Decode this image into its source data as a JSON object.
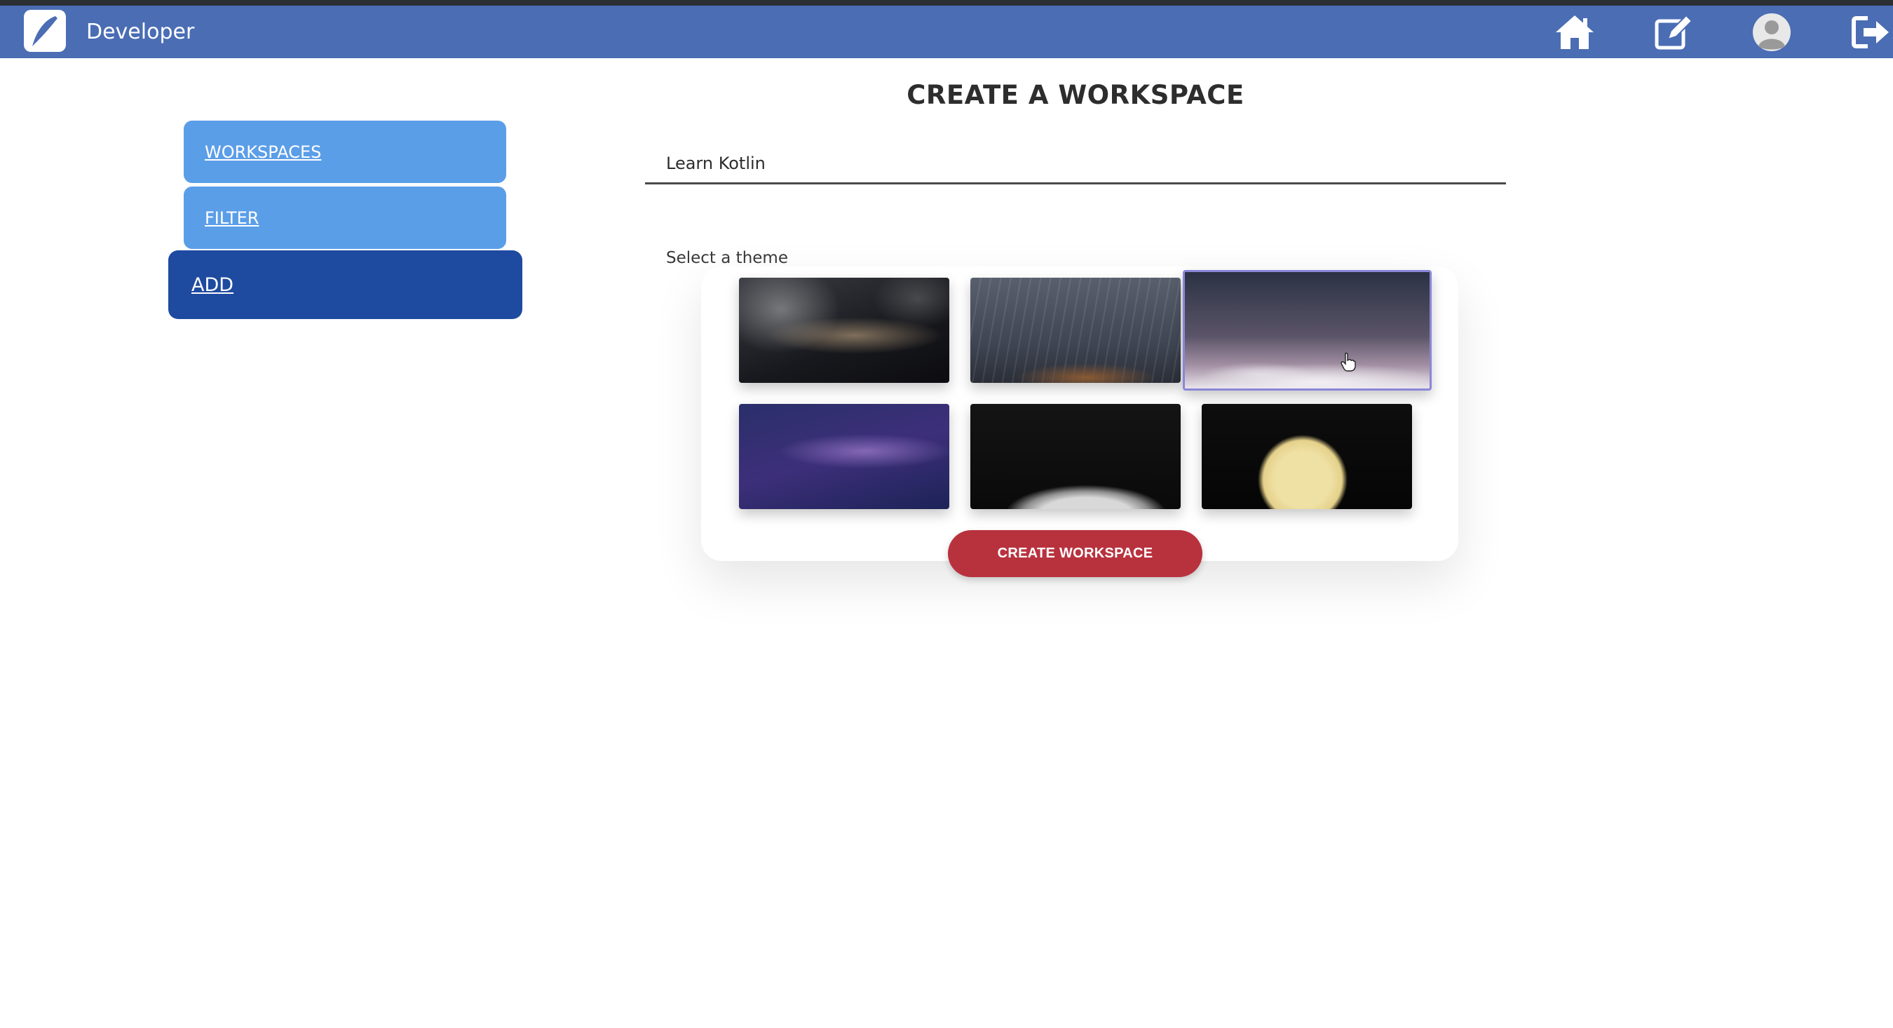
{
  "app": {
    "brand": "Developer"
  },
  "nav": {
    "icons": [
      "home-icon",
      "edit-icon",
      "profile-icon",
      "logout-icon"
    ]
  },
  "sidebar": {
    "items": [
      {
        "label": "WORKSPACES"
      },
      {
        "label": "FILTER"
      },
      {
        "label": "ADD",
        "active": true
      }
    ]
  },
  "main": {
    "title": "CREATE A WORKSPACE",
    "name_value": "Learn Kotlin",
    "theme_label": "Select a theme",
    "themes": [
      {
        "name": "milky-way-clouds"
      },
      {
        "name": "star-trails-mesa"
      },
      {
        "name": "snowy-peaks-night",
        "selected": true
      },
      {
        "name": "purple-galaxy"
      },
      {
        "name": "planet-horizon"
      },
      {
        "name": "full-moon"
      }
    ],
    "create_label": "CREATE WORKSPACE"
  },
  "colors": {
    "navbar": "#4a6db4",
    "sidebar_button": "#5b9ee8",
    "sidebar_active": "#1e4aa0",
    "create_button": "#b8323e",
    "selected_border": "#8a86d8"
  }
}
